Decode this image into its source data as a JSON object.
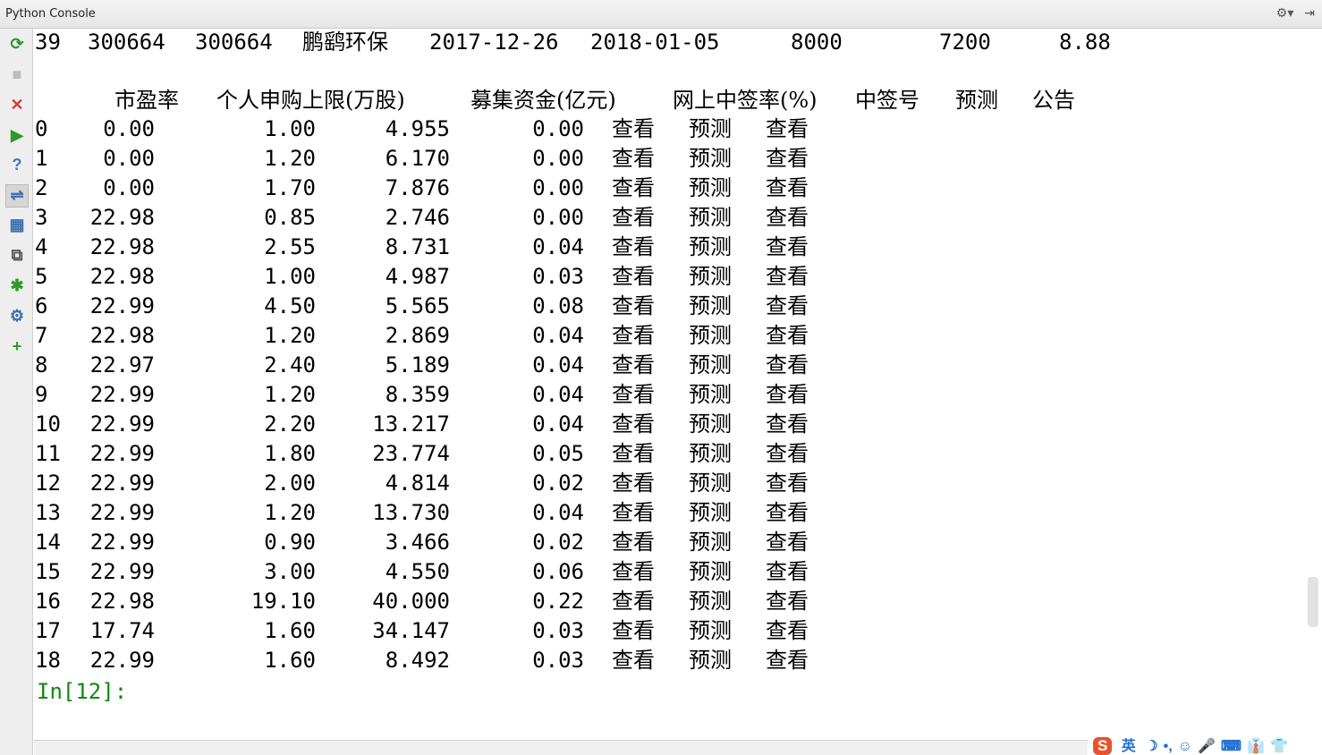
{
  "window": {
    "title": "Python Console",
    "settings_icon": "⚙▾",
    "hide_icon": "⇥"
  },
  "toolbar": {
    "buttons": [
      {
        "name": "rerun-icon",
        "glyph": "⟳",
        "color": "#2e9a2e"
      },
      {
        "name": "stop-icon",
        "glyph": "■",
        "color": "#bdbdbd"
      },
      {
        "name": "close-icon",
        "glyph": "✕",
        "color": "#d83a3a"
      },
      {
        "name": "run-icon",
        "glyph": "▶",
        "color": "#2e9a2e"
      },
      {
        "name": "help-icon",
        "glyph": "?",
        "color": "#3a7bd5"
      },
      {
        "name": "soft-wrap-icon",
        "glyph": "⇌",
        "color": "#3a6fb0"
      },
      {
        "name": "variables-icon",
        "glyph": "▦",
        "color": "#3a6fb0"
      },
      {
        "name": "attach-debugger-icon",
        "glyph": "⧉",
        "color": "#555555"
      },
      {
        "name": "debug-icon",
        "glyph": "✱",
        "color": "#2e9a2e"
      },
      {
        "name": "settings-icon",
        "glyph": "⚙",
        "color": "#3a6fb0"
      },
      {
        "name": "new-console-icon",
        "glyph": "+",
        "color": "#2e9a2e"
      }
    ]
  },
  "console": {
    "top_row": {
      "index": "39",
      "code1": "300664",
      "code2": "300664",
      "name": "鹏鹞环保",
      "date1": "2017-12-26",
      "date2": "2018-01-05",
      "v1": "8000",
      "v2": "7200",
      "v3": "8.88"
    },
    "headers": [
      "市盈率",
      "个人申购上限(万股)",
      "募集资金(亿元)",
      "网上中签率(%)",
      "中签号",
      "预测",
      "公告"
    ],
    "rows": [
      {
        "idx": "0",
        "pe": "0.00",
        "limit": "1.00",
        "fund": "4.955",
        "rate": "0.00",
        "a": "查看",
        "b": "预测",
        "c": "查看"
      },
      {
        "idx": "1",
        "pe": "0.00",
        "limit": "1.20",
        "fund": "6.170",
        "rate": "0.00",
        "a": "查看",
        "b": "预测",
        "c": "查看"
      },
      {
        "idx": "2",
        "pe": "0.00",
        "limit": "1.70",
        "fund": "7.876",
        "rate": "0.00",
        "a": "查看",
        "b": "预测",
        "c": "查看"
      },
      {
        "idx": "3",
        "pe": "22.98",
        "limit": "0.85",
        "fund": "2.746",
        "rate": "0.00",
        "a": "查看",
        "b": "预测",
        "c": "查看"
      },
      {
        "idx": "4",
        "pe": "22.98",
        "limit": "2.55",
        "fund": "8.731",
        "rate": "0.04",
        "a": "查看",
        "b": "预测",
        "c": "查看"
      },
      {
        "idx": "5",
        "pe": "22.98",
        "limit": "1.00",
        "fund": "4.987",
        "rate": "0.03",
        "a": "查看",
        "b": "预测",
        "c": "查看"
      },
      {
        "idx": "6",
        "pe": "22.99",
        "limit": "4.50",
        "fund": "5.565",
        "rate": "0.08",
        "a": "查看",
        "b": "预测",
        "c": "查看"
      },
      {
        "idx": "7",
        "pe": "22.98",
        "limit": "1.20",
        "fund": "2.869",
        "rate": "0.04",
        "a": "查看",
        "b": "预测",
        "c": "查看"
      },
      {
        "idx": "8",
        "pe": "22.97",
        "limit": "2.40",
        "fund": "5.189",
        "rate": "0.04",
        "a": "查看",
        "b": "预测",
        "c": "查看"
      },
      {
        "idx": "9",
        "pe": "22.99",
        "limit": "1.20",
        "fund": "8.359",
        "rate": "0.04",
        "a": "查看",
        "b": "预测",
        "c": "查看"
      },
      {
        "idx": "10",
        "pe": "22.99",
        "limit": "2.20",
        "fund": "13.217",
        "rate": "0.04",
        "a": "查看",
        "b": "预测",
        "c": "查看"
      },
      {
        "idx": "11",
        "pe": "22.99",
        "limit": "1.80",
        "fund": "23.774",
        "rate": "0.05",
        "a": "查看",
        "b": "预测",
        "c": "查看"
      },
      {
        "idx": "12",
        "pe": "22.99",
        "limit": "2.00",
        "fund": "4.814",
        "rate": "0.02",
        "a": "查看",
        "b": "预测",
        "c": "查看"
      },
      {
        "idx": "13",
        "pe": "22.99",
        "limit": "1.20",
        "fund": "13.730",
        "rate": "0.04",
        "a": "查看",
        "b": "预测",
        "c": "查看"
      },
      {
        "idx": "14",
        "pe": "22.99",
        "limit": "0.90",
        "fund": "3.466",
        "rate": "0.02",
        "a": "查看",
        "b": "预测",
        "c": "查看"
      },
      {
        "idx": "15",
        "pe": "22.99",
        "limit": "3.00",
        "fund": "4.550",
        "rate": "0.06",
        "a": "查看",
        "b": "预测",
        "c": "查看"
      },
      {
        "idx": "16",
        "pe": "22.98",
        "limit": "19.10",
        "fund": "40.000",
        "rate": "0.22",
        "a": "查看",
        "b": "预测",
        "c": "查看"
      },
      {
        "idx": "17",
        "pe": "17.74",
        "limit": "1.60",
        "fund": "34.147",
        "rate": "0.03",
        "a": "查看",
        "b": "预测",
        "c": "查看"
      },
      {
        "idx": "18",
        "pe": "22.99",
        "limit": "1.60",
        "fund": "8.492",
        "rate": "0.03",
        "a": "查看",
        "b": "预测",
        "c": "查看"
      }
    ],
    "prompt": "In[12]:"
  },
  "tray": {
    "ime_logo": "S",
    "lang": "英",
    "items": [
      "☽",
      "•,",
      "☺",
      "🎤",
      "⌨",
      "👔",
      "👕"
    ]
  }
}
